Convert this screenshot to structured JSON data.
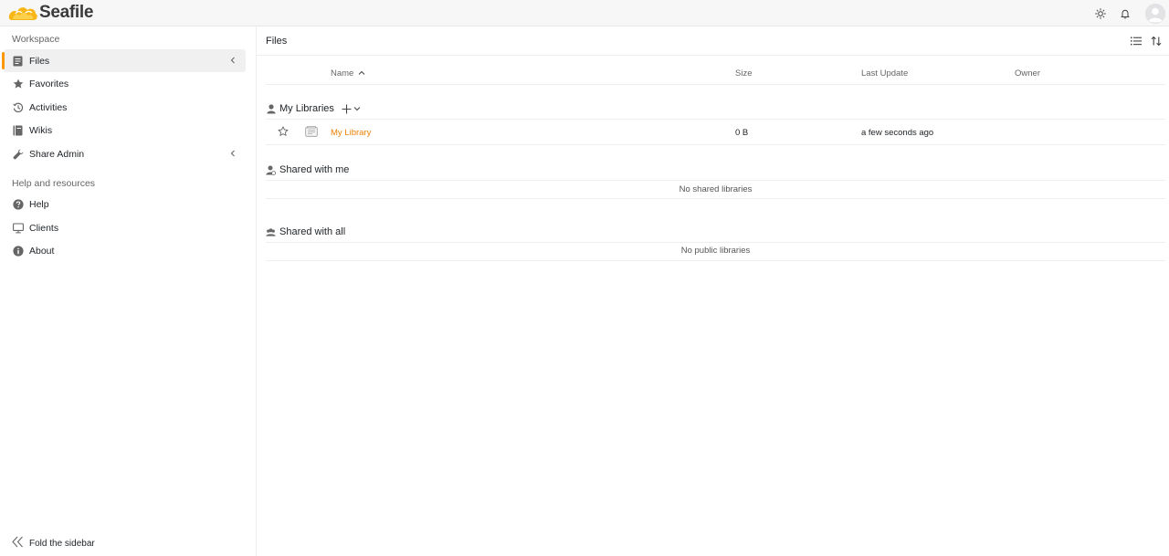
{
  "app": {
    "logo_text": "Seafile"
  },
  "header": {
    "icons": [
      "theme-sun-icon",
      "bell-icon",
      "user-avatar"
    ]
  },
  "sidebar": {
    "workspace_heading": "Workspace",
    "items": [
      {
        "label": "Files",
        "icon": "file-icon",
        "active": true,
        "has_chevron": true
      },
      {
        "label": "Favorites",
        "icon": "star-icon"
      },
      {
        "label": "Activities",
        "icon": "history-icon"
      },
      {
        "label": "Wikis",
        "icon": "wiki-book-icon"
      },
      {
        "label": "Share Admin",
        "icon": "wrench-icon",
        "has_chevron": true
      }
    ],
    "help_heading": "Help and resources",
    "help_items": [
      {
        "label": "Help",
        "icon": "question-icon"
      },
      {
        "label": "Clients",
        "icon": "monitor-icon"
      },
      {
        "label": "About",
        "icon": "info-icon"
      }
    ],
    "fold_label": "Fold the sidebar"
  },
  "main": {
    "title": "Files",
    "actions": [
      "list-view-icon",
      "sort-icon"
    ],
    "columns": {
      "name": "Name",
      "size": "Size",
      "last_update": "Last Update",
      "owner": "Owner"
    },
    "sections": {
      "my_libraries": {
        "title": "My Libraries",
        "rows": [
          {
            "name": "My Library",
            "size": "0 B",
            "last_update": "a few seconds ago",
            "owner": ""
          }
        ]
      },
      "shared_with_me": {
        "title": "Shared with me",
        "empty": "No shared libraries"
      },
      "shared_with_all": {
        "title": "Shared with all",
        "empty": "No public libraries"
      }
    }
  },
  "colors": {
    "accent": "#ff9800",
    "link": "#eb8205",
    "logo_yellow": "#f8b516"
  }
}
